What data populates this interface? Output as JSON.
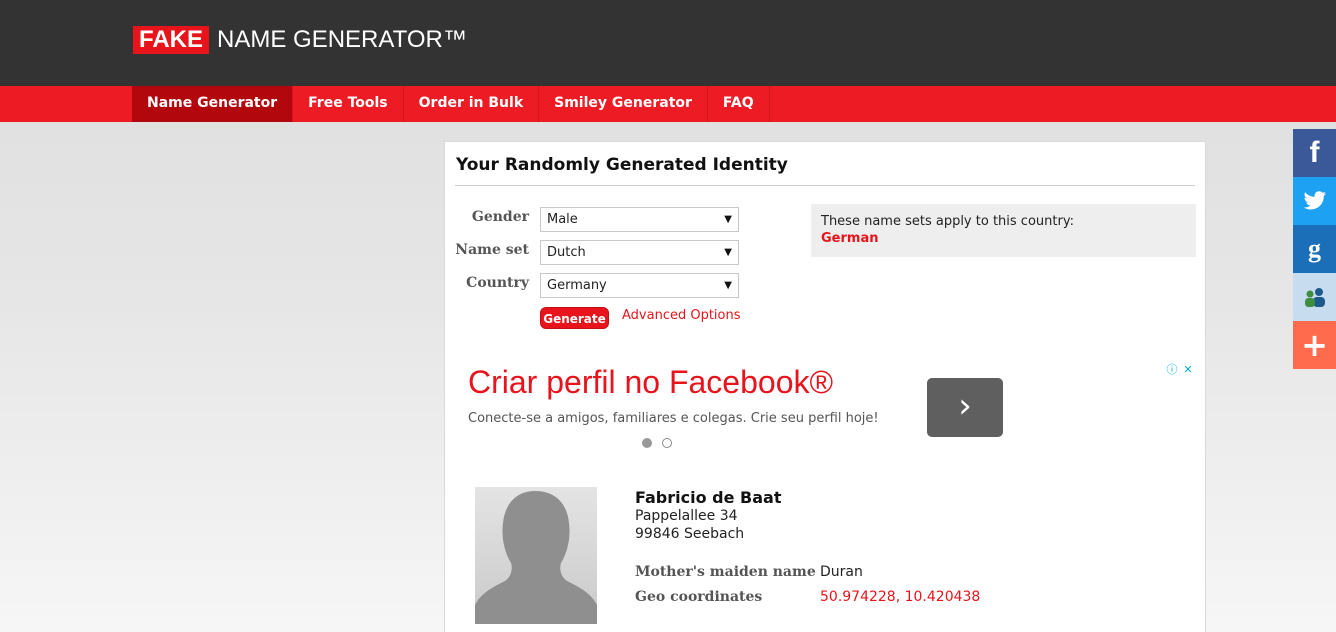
{
  "header": {
    "logo_fake": "FAKE",
    "logo_rest": "NAME GENERATOR™"
  },
  "nav": {
    "items": [
      {
        "label": "Name Generator"
      },
      {
        "label": "Free Tools"
      },
      {
        "label": "Order in Bulk"
      },
      {
        "label": "Smiley Generator"
      },
      {
        "label": "FAQ"
      }
    ]
  },
  "panel": {
    "title": "Your Randomly Generated Identity",
    "form": {
      "gender_label": "Gender",
      "gender_value": "Male",
      "nameset_label": "Name set",
      "nameset_value": "Dutch",
      "country_label": "Country",
      "country_value": "Germany",
      "generate_label": "Generate",
      "advanced_label": "Advanced Options"
    },
    "nameset_info": {
      "text": "These name sets apply to this country:",
      "country": "German"
    },
    "ad": {
      "title": "Criar perfil no Facebook®",
      "subtitle": "Conecte-se a amigos, familiares e colegas. Crie seu perfil hoje!",
      "button": "›",
      "info": "ⓘ",
      "close": "✕"
    },
    "identity": {
      "name": "Fabricio de Baat",
      "street": "Pappelallee 34",
      "city": "99846 Seebach",
      "maiden_label": "Mother's maiden name",
      "maiden_value": "Duran",
      "geo_label": "Geo coordinates",
      "geo_value": "50.974228, 10.420438"
    }
  },
  "share": {
    "facebook": "f",
    "google": "g",
    "more": "+"
  },
  "colors": {
    "brand_red": "#ed1c24",
    "header_dark": "#333333"
  }
}
